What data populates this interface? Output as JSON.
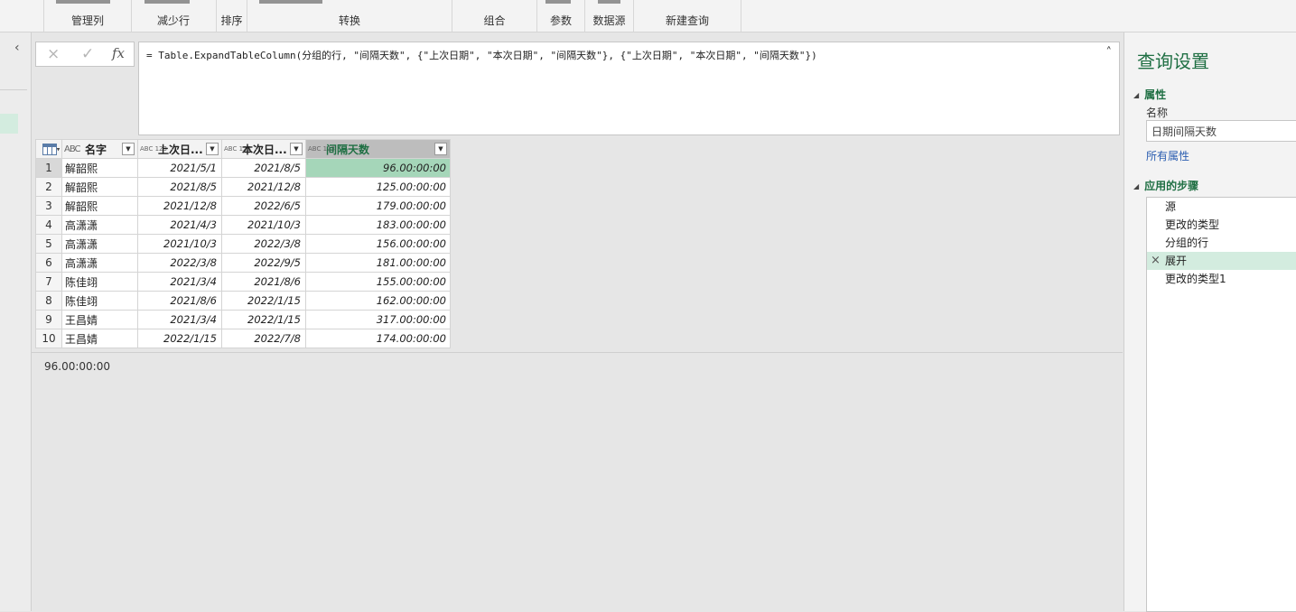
{
  "ribbon": {
    "groups": [
      "管理列",
      "减少行",
      "排序",
      "转换",
      "组合",
      "参数",
      "数据源",
      "新建查询"
    ]
  },
  "left_nav": {
    "collapse_icon": "chevron-left-icon"
  },
  "formula_bar": {
    "cancel_icon": "×",
    "commit_icon": "✓",
    "fx_label": "fx",
    "formula": "= Table.ExpandTableColumn(分组的行, \"间隔天数\", {\"上次日期\", \"本次日期\", \"间隔天数\"}, {\"上次日期\", \"本次日期\", \"间隔天数\"})",
    "collapse_icon": "chevron-up-icon"
  },
  "grid": {
    "columns": [
      {
        "type": "ABC",
        "label": "名字"
      },
      {
        "type": "ABC 123",
        "label": "上次日..."
      },
      {
        "type": "ABC 123",
        "label": "本次日..."
      },
      {
        "type": "ABC 123",
        "label": "间隔天数"
      }
    ],
    "rows": [
      {
        "n": "1",
        "name": "解韶熙",
        "last": "2021/5/1",
        "curr": "2021/8/5",
        "days": "96.00:00:00"
      },
      {
        "n": "2",
        "name": "解韶熙",
        "last": "2021/8/5",
        "curr": "2021/12/8",
        "days": "125.00:00:00"
      },
      {
        "n": "3",
        "name": "解韶熙",
        "last": "2021/12/8",
        "curr": "2022/6/5",
        "days": "179.00:00:00"
      },
      {
        "n": "4",
        "name": "高潇潇",
        "last": "2021/4/3",
        "curr": "2021/10/3",
        "days": "183.00:00:00"
      },
      {
        "n": "5",
        "name": "高潇潇",
        "last": "2021/10/3",
        "curr": "2022/3/8",
        "days": "156.00:00:00"
      },
      {
        "n": "6",
        "name": "高潇潇",
        "last": "2022/3/8",
        "curr": "2022/9/5",
        "days": "181.00:00:00"
      },
      {
        "n": "7",
        "name": "陈佳翊",
        "last": "2021/3/4",
        "curr": "2021/8/6",
        "days": "155.00:00:00"
      },
      {
        "n": "8",
        "name": "陈佳翊",
        "last": "2021/8/6",
        "curr": "2022/1/15",
        "days": "162.00:00:00"
      },
      {
        "n": "9",
        "name": "王昌婧",
        "last": "2021/3/4",
        "curr": "2022/1/15",
        "days": "317.00:00:00"
      },
      {
        "n": "10",
        "name": "王昌婧",
        "last": "2022/1/15",
        "curr": "2022/7/8",
        "days": "174.00:00:00"
      }
    ]
  },
  "preview_value": "96.00:00:00",
  "query_settings": {
    "title": "查询设置",
    "properties_header": "属性",
    "name_label": "名称",
    "name_value": "日期间隔天数",
    "all_properties_link": "所有属性",
    "applied_steps_header": "应用的步骤",
    "steps": [
      "源",
      "更改的类型",
      "分组的行",
      "展开",
      "更改的类型1"
    ],
    "active_step": "展开"
  },
  "colors": {
    "accent": "#1f6f43",
    "selection": "#a5d6b9",
    "active_step": "#d3ecdf",
    "link": "#2a5db0"
  }
}
